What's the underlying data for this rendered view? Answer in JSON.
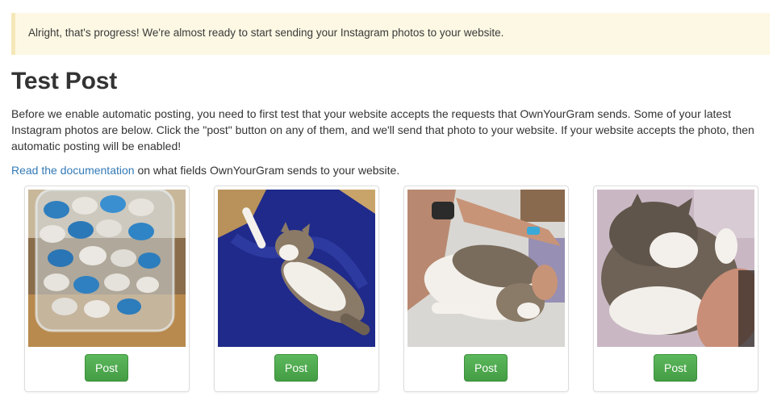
{
  "alert": {
    "message": "Alright, that's progress! We're almost ready to start sending your Instagram photos to your website."
  },
  "page": {
    "title": "Test Post",
    "intro": "Before we enable automatic posting, you need to first test that your website accepts the requests that OwnYourGram sends. Some of your latest Instagram photos are below. Click the \"post\" button on any of them, and we'll send that photo to your website. If your website accepts the photo, then automatic posting will be enabled!",
    "doc_link_text": "Read the documentation",
    "doc_suffix": " on what fields OwnYourGram sends to your website."
  },
  "colors": {
    "alert_bg": "#fcf8e3",
    "link": "#337ab7",
    "button": "#5cb85c"
  },
  "photos": [
    {
      "subject": "jar-of-candies-photo",
      "button_label": "Post"
    },
    {
      "subject": "cat-on-blue-blanket-photo",
      "button_label": "Post"
    },
    {
      "subject": "cat-held-in-arm-photo",
      "button_label": "Post"
    },
    {
      "subject": "cat-with-paw-on-hand-photo",
      "button_label": "Post"
    }
  ]
}
